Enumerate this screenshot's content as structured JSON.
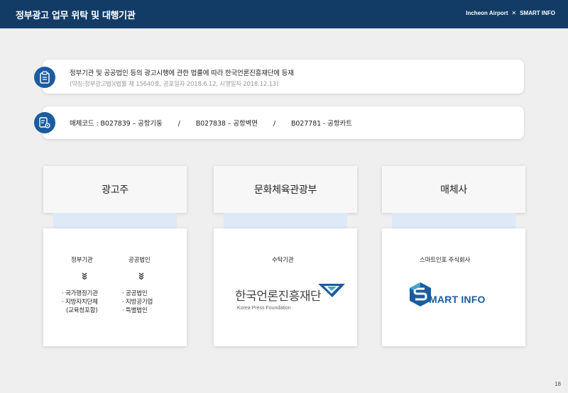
{
  "header": {
    "title": "정부광고 업무 위탁 및 대행기관",
    "brand_left": "Incheon Airport",
    "brand_sep": "✕",
    "brand_right": "SMART INFO"
  },
  "info1": {
    "line1": "정부기관 및 공공법인 등의 광고시행에 관한 법률에 따라 한국언론진흥재단에 등재",
    "line2": "(약칭:정부광고법)(법률 제 15640호, 공포일자 2018.6.12, 시행일자 2018.12.13)",
    "icon": "clipboard-icon"
  },
  "info2": {
    "prefix": "매체코드 : ",
    "codes": [
      "B027839 – 공항기둥",
      "B027838 – 공항벽면",
      "B027781 - 공항카트"
    ],
    "separator": "/",
    "icon": "document-settings-icon"
  },
  "columns": [
    {
      "title": "광고주",
      "groups": [
        {
          "label": "정부기관",
          "items": [
            "· 국가행정기관",
            "· 지방자치단체",
            "(교육청포함)"
          ]
        },
        {
          "label": "공공법인",
          "items": [
            "· 공공법인",
            "· 지방공기업",
            "· 특별법인"
          ]
        }
      ]
    },
    {
      "title": "문화체육관광부",
      "label": "수탁기관",
      "logo_text": "한국언론진흥재단",
      "logo_sub": "Korea Press Foundation"
    },
    {
      "title": "매체사",
      "label": "스마트인포 주식회사",
      "logo_letter": "S",
      "logo_text": "MART INFO"
    }
  ],
  "page_number": "18",
  "colors": {
    "navy": "#123c66",
    "accent": "#1b5ca0",
    "connector": "#dde9f6"
  }
}
